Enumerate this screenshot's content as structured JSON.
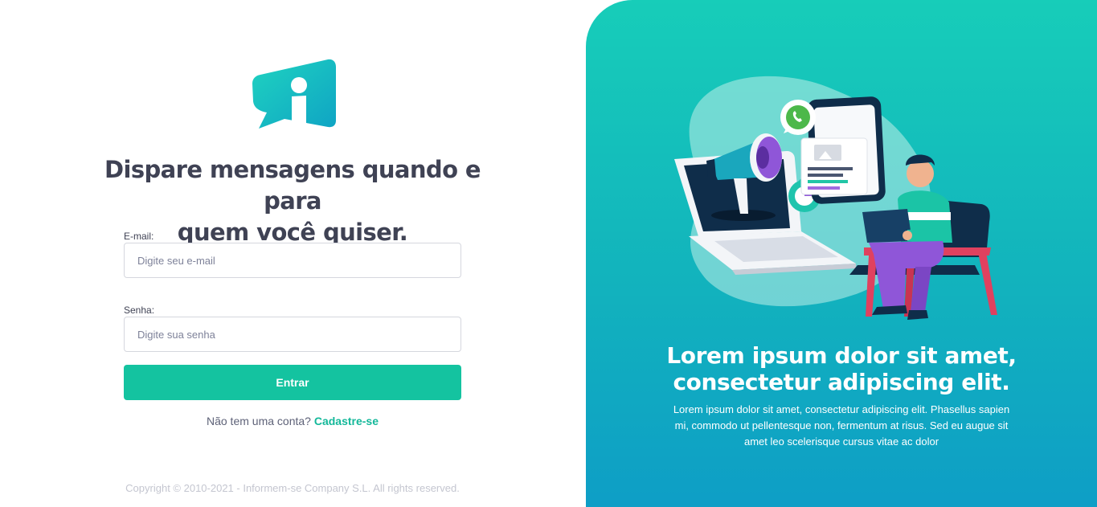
{
  "brand": {
    "logo_letter": "i",
    "colors": {
      "accent": "#14c3a0",
      "text": "#3f4254",
      "panel_top": "#17cdb9",
      "panel_bottom": "#0e9ec6"
    }
  },
  "login": {
    "headline_line1": "Dispare mensagens quando e para",
    "headline_line2": "quem você quiser.",
    "email_label": "E-mail:",
    "email_placeholder": "Digite seu e-mail",
    "email_value": "",
    "password_label": "Senha:",
    "password_placeholder": "Digite sua senha",
    "password_value": "",
    "submit_label": "Entrar",
    "signup_prompt": "Não tem uma conta?",
    "signup_link": "Cadastre-se"
  },
  "footer": {
    "copyright": "Copyright © 2010-2021 - Informem-se Company S.L. All rights reserved."
  },
  "promo": {
    "title_line1": "Lorem ipsum dolor sit amet,",
    "title_line2": "consectetur adipiscing elit.",
    "text": "Lorem ipsum dolor sit amet, consectetur adipiscing elit. Phasellus sapien mi, commodo ut pellentesque non, fermentum at risus. Sed eu augue sit amet leo scelerisque cursus vitae ac dolor",
    "illustration_icons": [
      "megaphone-icon",
      "whatsapp-icon",
      "smartphone-icon",
      "laptop-icon",
      "pie-chart-icon",
      "person-with-laptop-icon"
    ]
  }
}
